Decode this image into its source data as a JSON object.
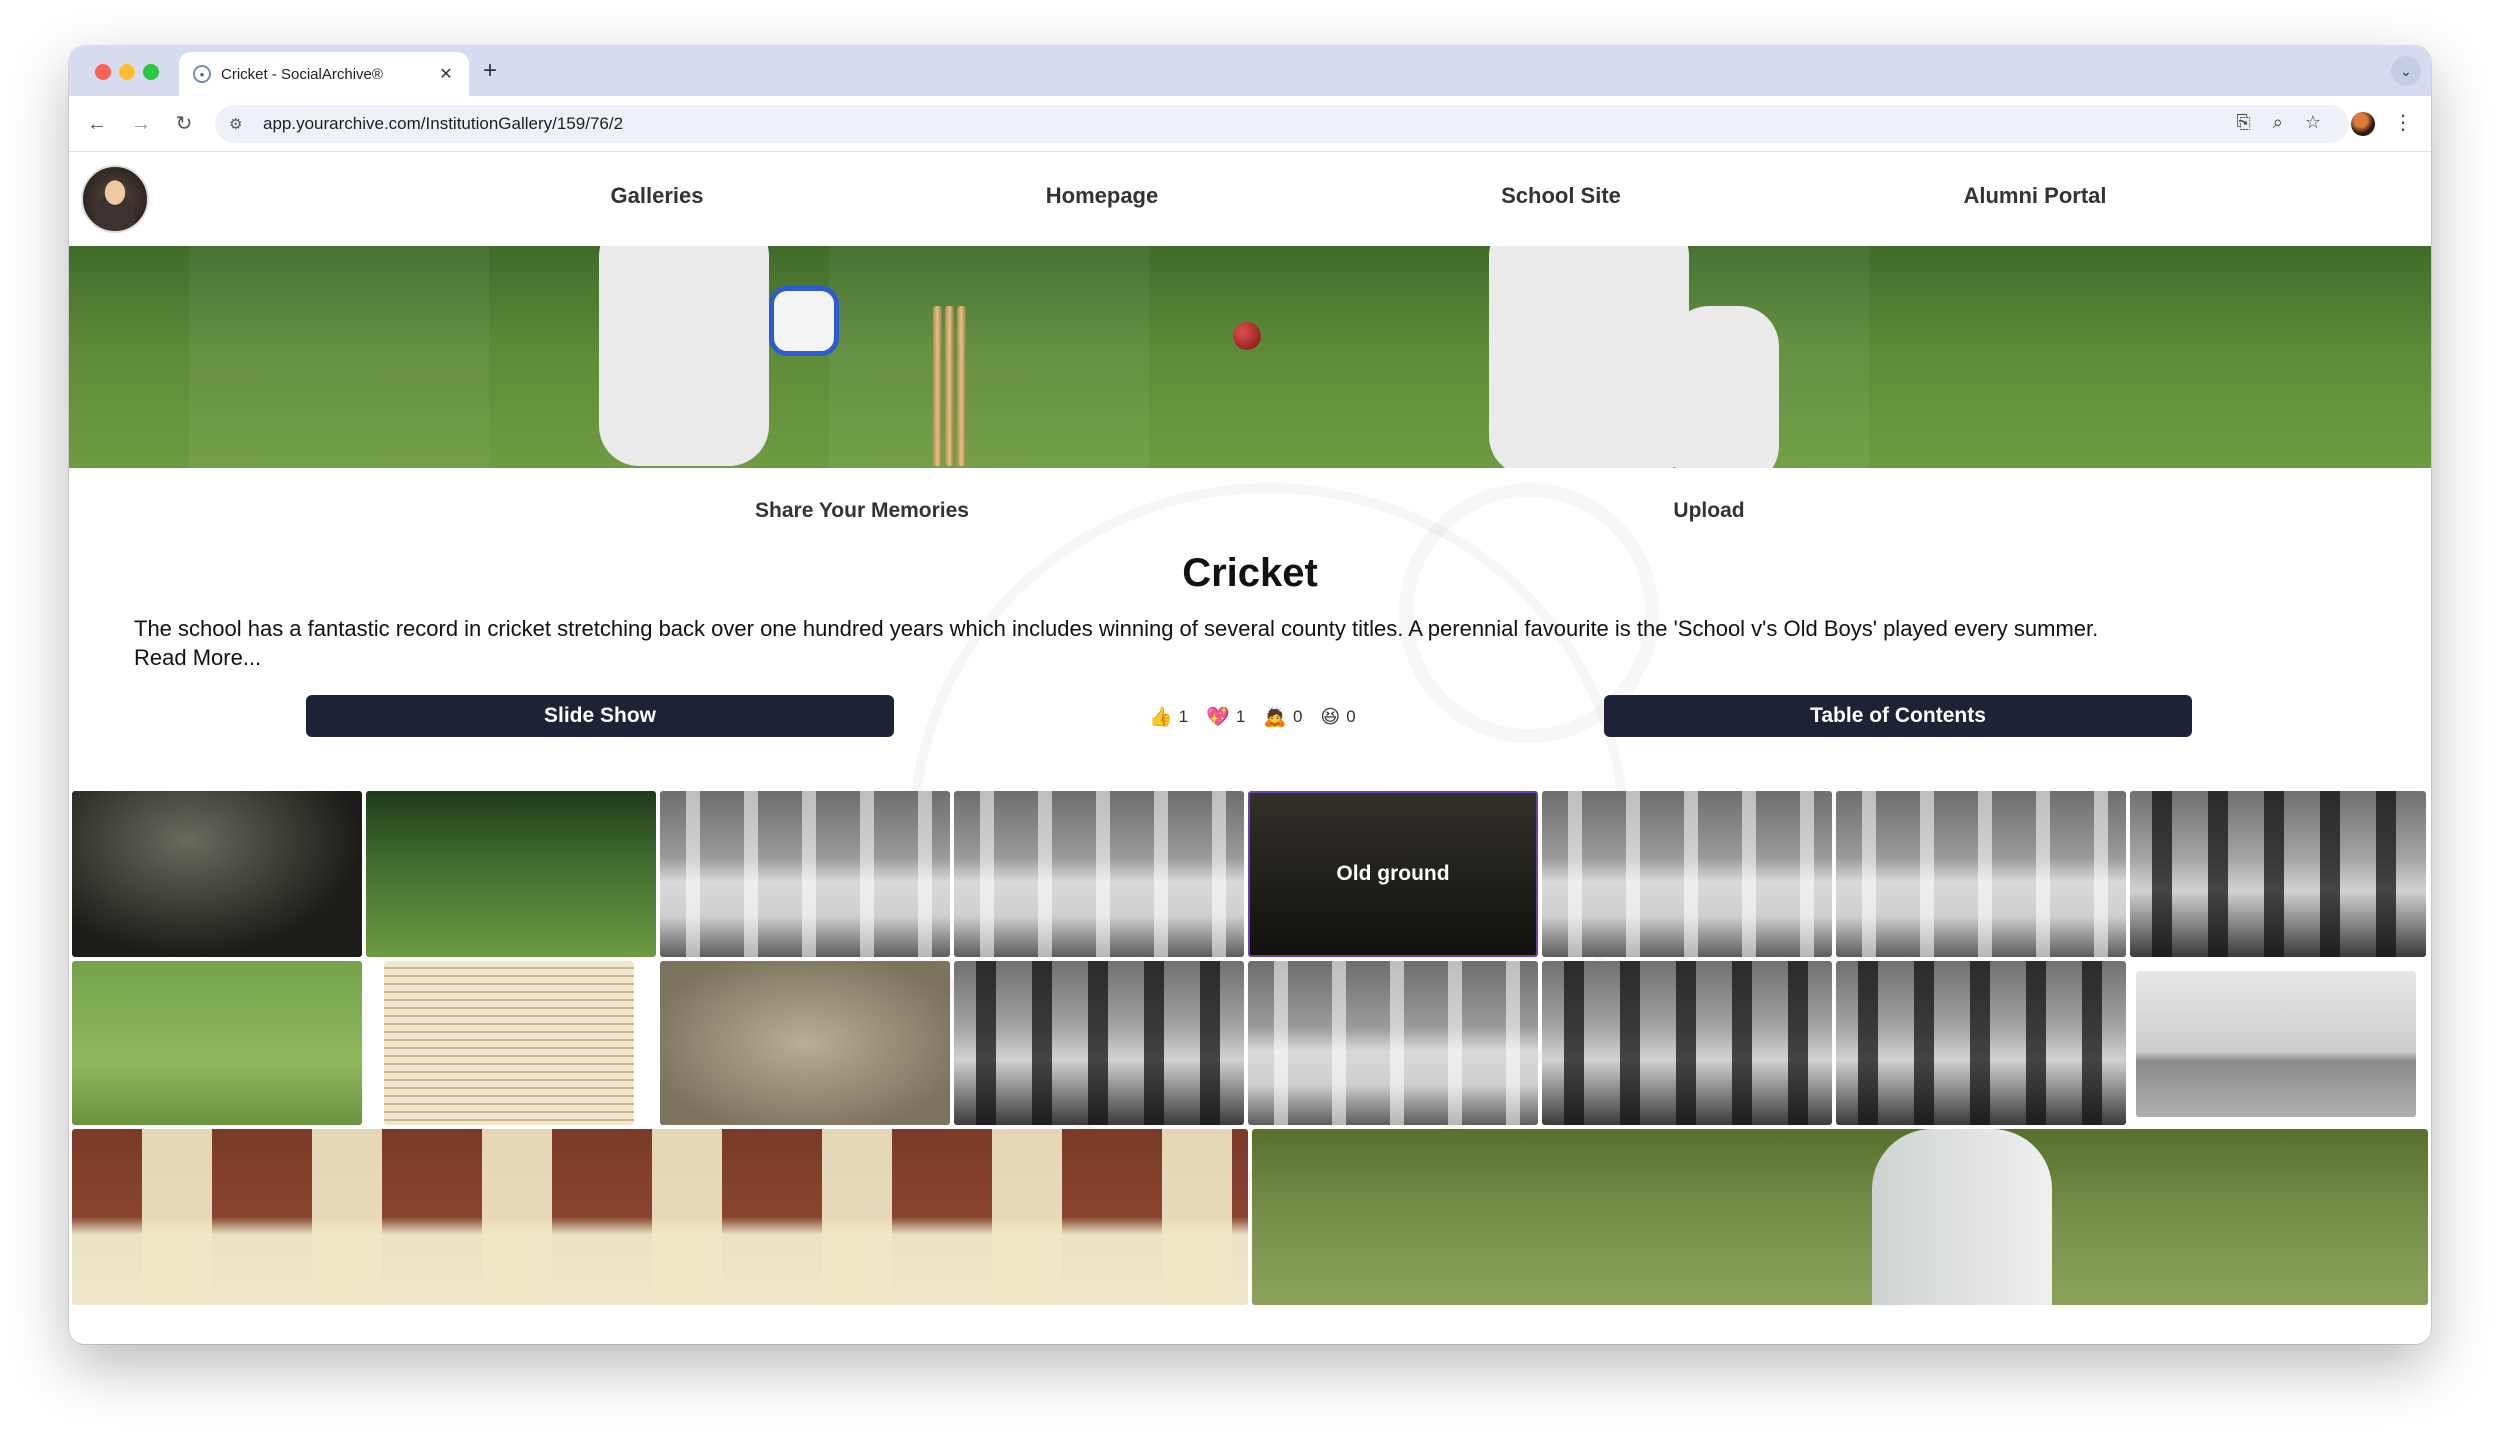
{
  "browser": {
    "tab_title": "Cricket - SocialArchive®",
    "tab_close": "✕",
    "new_tab": "+",
    "url": "app.yourarchive.com/InstitutionGallery/159/76/2"
  },
  "site_nav": {
    "items": [
      "Galleries",
      "Homepage",
      "School Site",
      "Alumni Portal"
    ]
  },
  "sub_nav": {
    "share": "Share Your Memories",
    "upload": "Upload"
  },
  "gallery": {
    "title": "Cricket",
    "description": "The school has a fantastic record in cricket stretching back over one hundred years which includes winning of several county titles. A perennial favourite is the 'School v's Old Boys' played every summer.",
    "read_more": "Read More...",
    "slideshow_label": "Slide Show",
    "toc_label": "Table of Contents"
  },
  "reactions": [
    {
      "icon": "👍",
      "name": "thumbs-up-icon",
      "count": "1"
    },
    {
      "icon": "💖",
      "name": "heart-icon",
      "count": "1"
    },
    {
      "icon": "🙇",
      "name": "bow-icon",
      "count": "0"
    },
    {
      "icon": "😆",
      "name": "laugh-icon",
      "count": "0"
    }
  ],
  "photos": {
    "hover_label": "Old ground"
  }
}
